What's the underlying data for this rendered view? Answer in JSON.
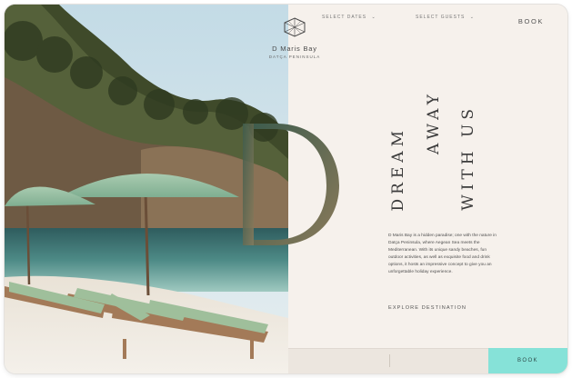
{
  "brand": {
    "name": "D Maris Bay",
    "subtitle": "DATÇA PENINSULA"
  },
  "header": {
    "book_label": "BOOK"
  },
  "hero": {
    "line1": "DREAM",
    "line2": "AWAY",
    "line3": "WITH US"
  },
  "description": "D Maris Bay is a hidden paradise; one with the nature in Datça Peninsula, where Aegean Sea meets the Mediterranean. With its unique sandy beaches, fun outdoor activities, as well as exquisite food and drink options, it hosts an impressive concept to give you an unforgettable holiday experience.",
  "explore_label": "EXPLORE DESTINATION",
  "booking_bar": {
    "dates_label": "SELECT DATES",
    "guests_label": "SELECT GUESTS",
    "book_label": "BOOK"
  },
  "colors": {
    "accent": "#86e2d8",
    "background": "#f6f1ec",
    "text": "#3b3b3b"
  },
  "icons": {
    "logo": "cube-logo-icon",
    "dropdown": "chevron-down-icon"
  }
}
